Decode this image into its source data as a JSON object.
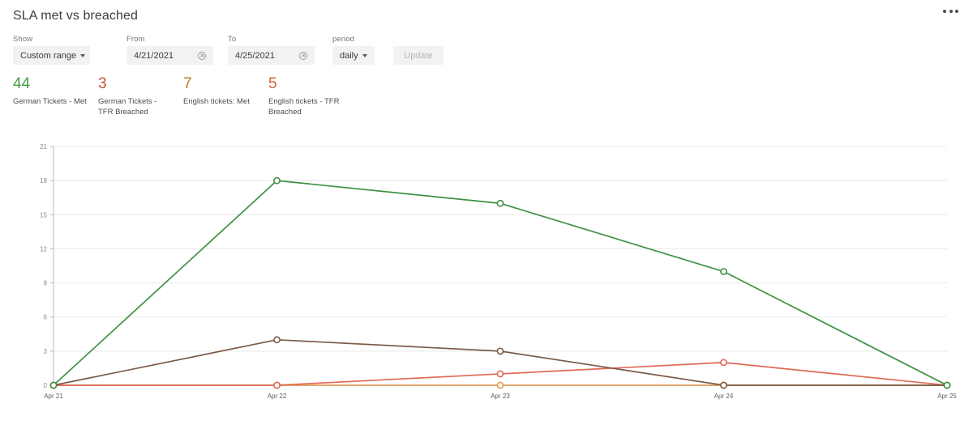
{
  "header": {
    "title": "SLA met vs breached",
    "menu_icon": "kebab-menu-icon"
  },
  "filters": {
    "show": {
      "label": "Show",
      "value": "Custom range",
      "caret_icon": "chevron-down-icon"
    },
    "from": {
      "label": "From",
      "value": "4/21/2021",
      "clear_icon": "clear-circle-icon"
    },
    "to": {
      "label": "To",
      "value": "4/25/2021",
      "clear_icon": "clear-circle-icon"
    },
    "period": {
      "label": "period",
      "value": "daily",
      "caret_icon": "chevron-down-icon"
    },
    "update_button": "Update"
  },
  "kpis": [
    {
      "value": "44",
      "label": "German Tickets - Met",
      "color": "#4a9a4a"
    },
    {
      "value": "3",
      "label": "German Tickets - TFR Breached",
      "color": "#c0563a"
    },
    {
      "value": "7",
      "label": "English tickets: Met",
      "color": "#c07a2a"
    },
    {
      "value": "5",
      "label": "English tickets - TFR Breached",
      "color": "#d4603f"
    }
  ],
  "chart_data": {
    "type": "line",
    "title": "SLA met vs breached",
    "xlabel": "",
    "ylabel": "",
    "x": [
      "Apr 21",
      "Apr 22",
      "Apr 23",
      "Apr 24",
      "Apr 25"
    ],
    "ylim": [
      0,
      21
    ],
    "yticks": [
      0,
      3,
      6,
      9,
      12,
      15,
      18,
      21
    ],
    "grid": true,
    "legend": "none",
    "markers": "open-circle",
    "series": [
      {
        "name": "German Tickets - Met",
        "color": "#3f9142",
        "values": [
          0,
          18,
          16,
          10,
          0
        ]
      },
      {
        "name": "German Tickets - TFR Breached",
        "color": "#7a5a47",
        "values": [
          0,
          4,
          3,
          0,
          0
        ]
      },
      {
        "name": "English tickets - TFR Breached",
        "color": "#df6a55",
        "values": [
          0,
          0,
          1,
          2,
          0
        ]
      },
      {
        "name": "English tickets: Met",
        "color": "#e09b55",
        "values": [
          0,
          0,
          0,
          0,
          0
        ]
      }
    ]
  }
}
